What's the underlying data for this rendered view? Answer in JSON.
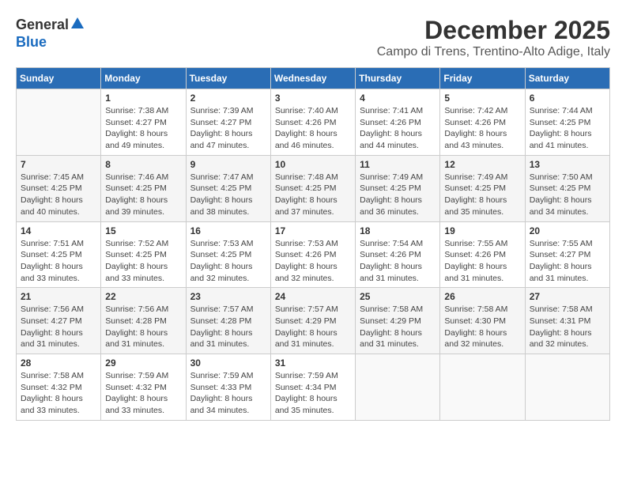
{
  "logo": {
    "general": "General",
    "blue": "Blue"
  },
  "title": {
    "month_year": "December 2025",
    "location": "Campo di Trens, Trentino-Alto Adige, Italy"
  },
  "days_of_week": [
    "Sunday",
    "Monday",
    "Tuesday",
    "Wednesday",
    "Thursday",
    "Friday",
    "Saturday"
  ],
  "weeks": [
    [
      {
        "day": "",
        "info": ""
      },
      {
        "day": "1",
        "info": "Sunrise: 7:38 AM\nSunset: 4:27 PM\nDaylight: 8 hours\nand 49 minutes."
      },
      {
        "day": "2",
        "info": "Sunrise: 7:39 AM\nSunset: 4:27 PM\nDaylight: 8 hours\nand 47 minutes."
      },
      {
        "day": "3",
        "info": "Sunrise: 7:40 AM\nSunset: 4:26 PM\nDaylight: 8 hours\nand 46 minutes."
      },
      {
        "day": "4",
        "info": "Sunrise: 7:41 AM\nSunset: 4:26 PM\nDaylight: 8 hours\nand 44 minutes."
      },
      {
        "day": "5",
        "info": "Sunrise: 7:42 AM\nSunset: 4:26 PM\nDaylight: 8 hours\nand 43 minutes."
      },
      {
        "day": "6",
        "info": "Sunrise: 7:44 AM\nSunset: 4:25 PM\nDaylight: 8 hours\nand 41 minutes."
      }
    ],
    [
      {
        "day": "7",
        "info": "Sunrise: 7:45 AM\nSunset: 4:25 PM\nDaylight: 8 hours\nand 40 minutes."
      },
      {
        "day": "8",
        "info": "Sunrise: 7:46 AM\nSunset: 4:25 PM\nDaylight: 8 hours\nand 39 minutes."
      },
      {
        "day": "9",
        "info": "Sunrise: 7:47 AM\nSunset: 4:25 PM\nDaylight: 8 hours\nand 38 minutes."
      },
      {
        "day": "10",
        "info": "Sunrise: 7:48 AM\nSunset: 4:25 PM\nDaylight: 8 hours\nand 37 minutes."
      },
      {
        "day": "11",
        "info": "Sunrise: 7:49 AM\nSunset: 4:25 PM\nDaylight: 8 hours\nand 36 minutes."
      },
      {
        "day": "12",
        "info": "Sunrise: 7:49 AM\nSunset: 4:25 PM\nDaylight: 8 hours\nand 35 minutes."
      },
      {
        "day": "13",
        "info": "Sunrise: 7:50 AM\nSunset: 4:25 PM\nDaylight: 8 hours\nand 34 minutes."
      }
    ],
    [
      {
        "day": "14",
        "info": "Sunrise: 7:51 AM\nSunset: 4:25 PM\nDaylight: 8 hours\nand 33 minutes."
      },
      {
        "day": "15",
        "info": "Sunrise: 7:52 AM\nSunset: 4:25 PM\nDaylight: 8 hours\nand 33 minutes."
      },
      {
        "day": "16",
        "info": "Sunrise: 7:53 AM\nSunset: 4:25 PM\nDaylight: 8 hours\nand 32 minutes."
      },
      {
        "day": "17",
        "info": "Sunrise: 7:53 AM\nSunset: 4:26 PM\nDaylight: 8 hours\nand 32 minutes."
      },
      {
        "day": "18",
        "info": "Sunrise: 7:54 AM\nSunset: 4:26 PM\nDaylight: 8 hours\nand 31 minutes."
      },
      {
        "day": "19",
        "info": "Sunrise: 7:55 AM\nSunset: 4:26 PM\nDaylight: 8 hours\nand 31 minutes."
      },
      {
        "day": "20",
        "info": "Sunrise: 7:55 AM\nSunset: 4:27 PM\nDaylight: 8 hours\nand 31 minutes."
      }
    ],
    [
      {
        "day": "21",
        "info": "Sunrise: 7:56 AM\nSunset: 4:27 PM\nDaylight: 8 hours\nand 31 minutes."
      },
      {
        "day": "22",
        "info": "Sunrise: 7:56 AM\nSunset: 4:28 PM\nDaylight: 8 hours\nand 31 minutes."
      },
      {
        "day": "23",
        "info": "Sunrise: 7:57 AM\nSunset: 4:28 PM\nDaylight: 8 hours\nand 31 minutes."
      },
      {
        "day": "24",
        "info": "Sunrise: 7:57 AM\nSunset: 4:29 PM\nDaylight: 8 hours\nand 31 minutes."
      },
      {
        "day": "25",
        "info": "Sunrise: 7:58 AM\nSunset: 4:29 PM\nDaylight: 8 hours\nand 31 minutes."
      },
      {
        "day": "26",
        "info": "Sunrise: 7:58 AM\nSunset: 4:30 PM\nDaylight: 8 hours\nand 32 minutes."
      },
      {
        "day": "27",
        "info": "Sunrise: 7:58 AM\nSunset: 4:31 PM\nDaylight: 8 hours\nand 32 minutes."
      }
    ],
    [
      {
        "day": "28",
        "info": "Sunrise: 7:58 AM\nSunset: 4:32 PM\nDaylight: 8 hours\nand 33 minutes."
      },
      {
        "day": "29",
        "info": "Sunrise: 7:59 AM\nSunset: 4:32 PM\nDaylight: 8 hours\nand 33 minutes."
      },
      {
        "day": "30",
        "info": "Sunrise: 7:59 AM\nSunset: 4:33 PM\nDaylight: 8 hours\nand 34 minutes."
      },
      {
        "day": "31",
        "info": "Sunrise: 7:59 AM\nSunset: 4:34 PM\nDaylight: 8 hours\nand 35 minutes."
      },
      {
        "day": "",
        "info": ""
      },
      {
        "day": "",
        "info": ""
      },
      {
        "day": "",
        "info": ""
      }
    ]
  ]
}
